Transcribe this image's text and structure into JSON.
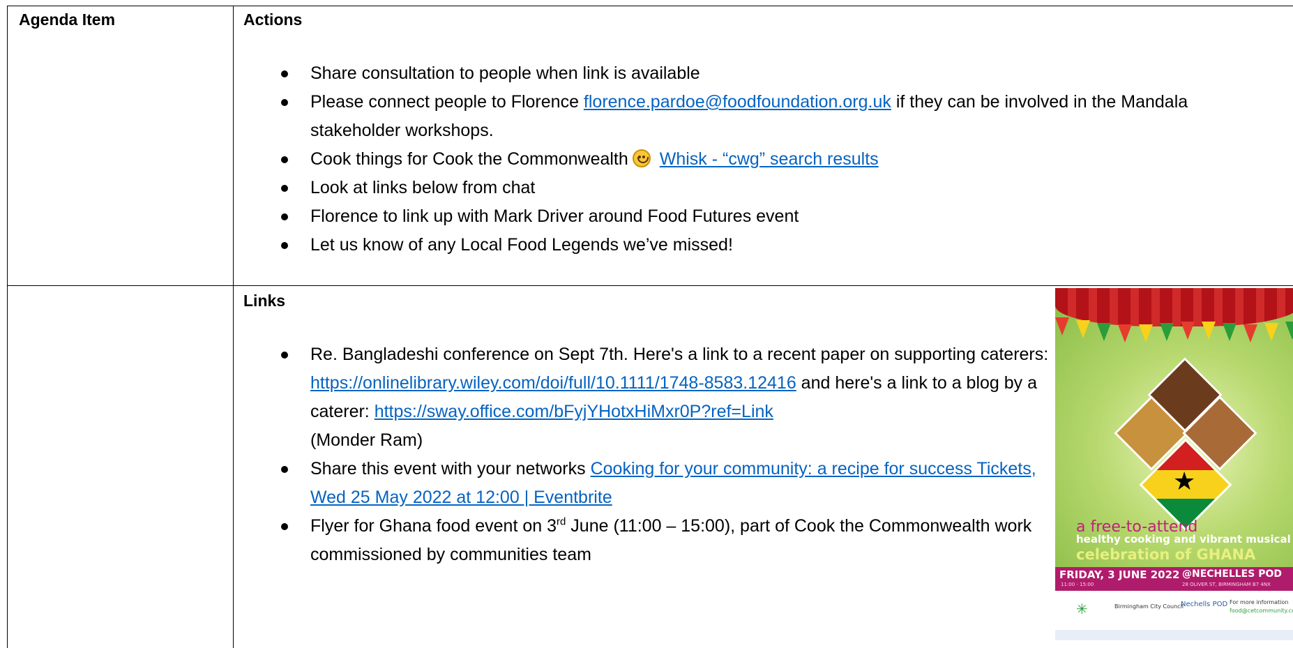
{
  "table": {
    "col1_header": "Agenda Item",
    "col2_header": "Actions"
  },
  "actions": {
    "item1": "Share consultation to people when link is available",
    "item2_pre": "Please connect people to Florence ",
    "item2_link": "florence.pardoe@foodfoundation.org.uk",
    "item2_post": " if they can be involved in the Mandala stakeholder workshops.",
    "item3_pre": "Cook things for Cook the Commonwealth",
    "item3_link": "Whisk - “cwg” search results",
    "item4": "Look at links below from chat",
    "item5": "Florence to link up with Mark Driver around Food Futures event",
    "item6": "Let us know of any Local Food Legends we’ve missed!"
  },
  "links": {
    "header": "Links",
    "item1_a": "Re. Bangladeshi conference on Sept 7th. Here's a link to a recent paper on supporting caterers: ",
    "item1_link1": "https://onlinelibrary.wiley.com/doi/full/10.1111/1748-8583.12416",
    "item1_b": " and here's a link to a blog by a caterer: ",
    "item1_link2": "https://sway.office.com/bFyjYHotxHiMxr0P?ref=Link",
    "item1_c": " (Monder Ram)",
    "item2_pre": "Share this event with your networks  ",
    "item2_link": "Cooking for your community: a recipe for success Tickets, Wed 25 May 2022 at 12:00 | Eventbrite",
    "item3_a": "Flyer for Ghana food event on 3",
    "item3_sup": "rd",
    "item3_b": " June (11:00 – 15:00), part of Cook the Commonwealth work commissioned by communities team"
  },
  "flyer": {
    "line1": "a free-to-attend",
    "line2": "healthy cooking and vibrant musical",
    "line3": "celebration of GHANA",
    "date": "FRIDAY, 3 JUNE 2022",
    "time": "11:00 - 15:00",
    "venue": "@NECHELLES POD",
    "address": "28 OLIVER ST, BIRMINGHAM B7 4NX",
    "logo1": "Birmingham City Council",
    "logo2": "Nechells POD",
    "info_label": "For more information",
    "info_email": "food@cetcommunity.co.uk"
  }
}
